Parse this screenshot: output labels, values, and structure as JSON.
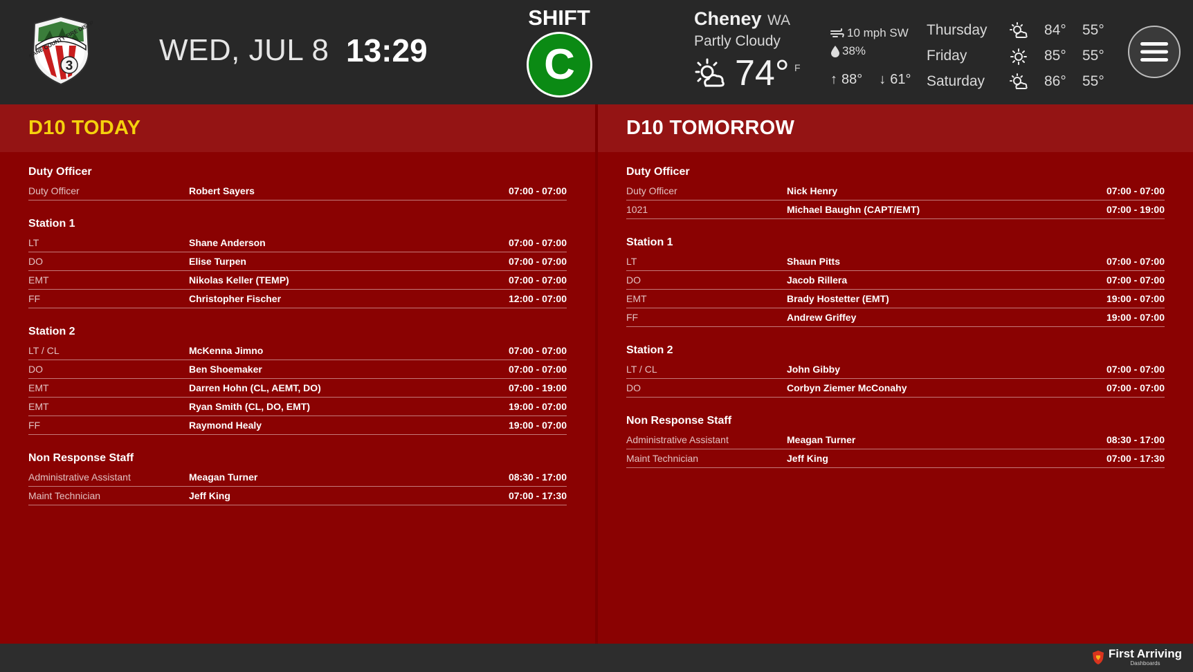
{
  "header": {
    "logo_text": "SPOKANE COUNTY FIRE DISTRICT",
    "logo_number": "3",
    "date": "WED, JUL 8",
    "time": "13:29",
    "shift_label": "SHIFT",
    "shift_value": "C"
  },
  "weather": {
    "city": "Cheney",
    "state": "WA",
    "condition": "Partly Cloudy",
    "current_temp": "74°",
    "unit": "F",
    "wind": "10 mph SW",
    "humidity": "38%",
    "high": "88°",
    "low": "61°",
    "current_icon": "partly-cloudy-icon",
    "forecast": [
      {
        "day": "Thursday",
        "icon": "partly-sunny-icon",
        "hi": "84°",
        "lo": "55°"
      },
      {
        "day": "Friday",
        "icon": "sunny-icon",
        "hi": "85°",
        "lo": "55°"
      },
      {
        "day": "Saturday",
        "icon": "partly-sunny-icon",
        "hi": "86°",
        "lo": "55°"
      }
    ]
  },
  "colors": {
    "header_bg": "#282828",
    "panel_bg": "#8a0202",
    "panel_head_bg": "#941414",
    "today_title": "#f5d10d",
    "shift_badge": "#0b8a14"
  },
  "today": {
    "title": "D10 TODAY",
    "groups": [
      {
        "title": "Duty Officer",
        "rows": [
          {
            "role": "Duty Officer",
            "name": "Robert Sayers",
            "hours": "07:00 - 07:00"
          }
        ]
      },
      {
        "title": "Station 1",
        "rows": [
          {
            "role": "LT",
            "name": "Shane Anderson",
            "hours": "07:00 - 07:00"
          },
          {
            "role": "DO",
            "name": "Elise Turpen",
            "hours": "07:00 - 07:00"
          },
          {
            "role": "EMT",
            "name": "Nikolas Keller (TEMP)",
            "hours": "07:00 - 07:00"
          },
          {
            "role": "FF",
            "name": "Christopher Fischer",
            "hours": "12:00 - 07:00"
          }
        ]
      },
      {
        "title": "Station 2",
        "rows": [
          {
            "role": "LT / CL",
            "name": "McKenna Jimno",
            "hours": "07:00 - 07:00"
          },
          {
            "role": "DO",
            "name": "Ben Shoemaker",
            "hours": "07:00 - 07:00"
          },
          {
            "role": "EMT",
            "name": "Darren Hohn (CL, AEMT, DO)",
            "hours": "07:00 - 19:00"
          },
          {
            "role": "EMT",
            "name": "Ryan Smith (CL, DO, EMT)",
            "hours": "19:00 - 07:00"
          },
          {
            "role": "FF",
            "name": "Raymond Healy",
            "hours": "19:00 - 07:00"
          }
        ]
      },
      {
        "title": "Non Response Staff",
        "rows": [
          {
            "role": "Administrative Assistant",
            "name": "Meagan Turner",
            "hours": "08:30 - 17:00"
          },
          {
            "role": "Maint Technician",
            "name": "Jeff King",
            "hours": "07:00 - 17:30"
          }
        ]
      }
    ]
  },
  "tomorrow": {
    "title": "D10 TOMORROW",
    "groups": [
      {
        "title": "Duty Officer",
        "rows": [
          {
            "role": "Duty Officer",
            "name": "Nick Henry",
            "hours": "07:00 - 07:00"
          },
          {
            "role": "1021",
            "name": "Michael Baughn (CAPT/EMT)",
            "hours": "07:00 - 19:00"
          }
        ]
      },
      {
        "title": "Station 1",
        "rows": [
          {
            "role": "LT",
            "name": "Shaun Pitts",
            "hours": "07:00 - 07:00"
          },
          {
            "role": "DO",
            "name": "Jacob Rillera",
            "hours": "07:00 - 07:00"
          },
          {
            "role": "EMT",
            "name": "Brady Hostetter (EMT)",
            "hours": "19:00 - 07:00"
          },
          {
            "role": "FF",
            "name": "Andrew Griffey",
            "hours": "19:00 - 07:00"
          }
        ]
      },
      {
        "title": "Station 2",
        "rows": [
          {
            "role": "LT / CL",
            "name": "John Gibby",
            "hours": "07:00 - 07:00"
          },
          {
            "role": "DO",
            "name": "Corbyn Ziemer McConahy",
            "hours": "07:00 - 07:00"
          }
        ]
      },
      {
        "title": "Non Response Staff",
        "rows": [
          {
            "role": "Administrative Assistant",
            "name": "Meagan Turner",
            "hours": "08:30 - 17:00"
          },
          {
            "role": "Maint Technician",
            "name": "Jeff King",
            "hours": "07:00 - 17:30"
          }
        ]
      }
    ]
  },
  "footer": {
    "brand_name": "First Arriving",
    "brand_sub": "Dashboards",
    "brand_icon": "shield-icon"
  },
  "menu": {
    "icon": "hamburger-menu-icon"
  }
}
